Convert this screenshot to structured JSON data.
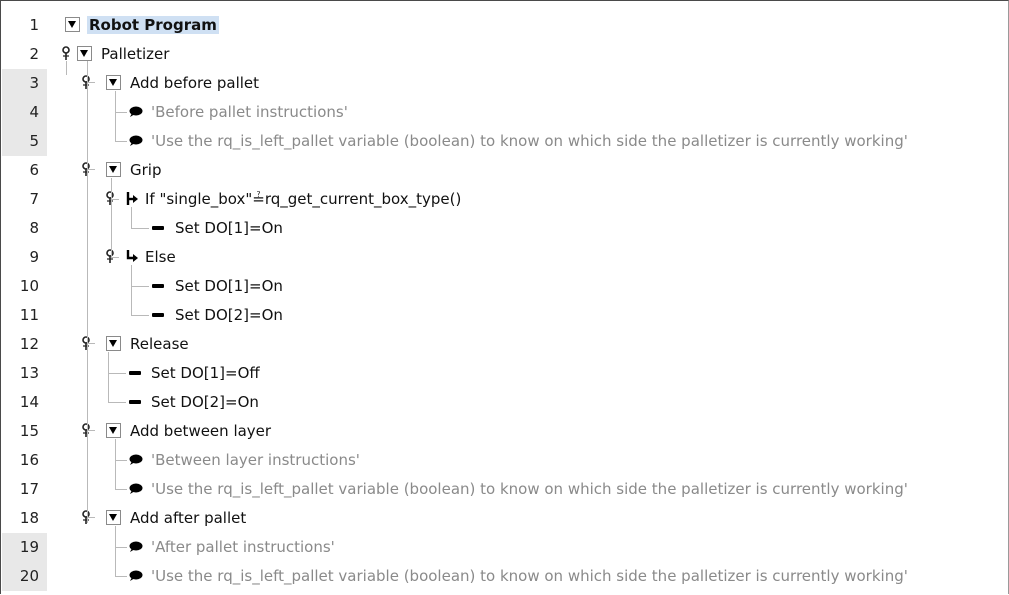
{
  "rows": [
    {
      "num": "1",
      "text": "Robot Program"
    },
    {
      "num": "2",
      "text": "Palletizer"
    },
    {
      "num": "3",
      "text": "Add before pallet"
    },
    {
      "num": "4",
      "text": "'Before pallet instructions'"
    },
    {
      "num": "5",
      "text": "'Use the rq_is_left_pallet variable (boolean) to know on which side the palletizer is currently working'"
    },
    {
      "num": "6",
      "text": "Grip"
    },
    {
      "num": "7",
      "text": "If \"single_box\"≟rq_get_current_box_type()"
    },
    {
      "num": "8",
      "text": "Set DO[1]=On"
    },
    {
      "num": "9",
      "text": "Else"
    },
    {
      "num": "10",
      "text": "Set DO[1]=On"
    },
    {
      "num": "11",
      "text": "Set DO[2]=On"
    },
    {
      "num": "12",
      "text": "Release"
    },
    {
      "num": "13",
      "text": "Set DO[1]=Off"
    },
    {
      "num": "14",
      "text": "Set DO[2]=On"
    },
    {
      "num": "15",
      "text": "Add between layer"
    },
    {
      "num": "16",
      "text": "'Between layer instructions'"
    },
    {
      "num": "17",
      "text": "'Use the rq_is_left_pallet variable (boolean) to know on which side the palletizer is currently working'"
    },
    {
      "num": "18",
      "text": "Add after pallet"
    },
    {
      "num": "19",
      "text": "'After pallet instructions'"
    },
    {
      "num": "20",
      "text": "'Use the rq_is_left_pallet variable (boolean) to know on which side the palletizer is currently working'"
    }
  ],
  "colors": {
    "selection": "#cfe0f3",
    "gutter_shade": "#e8e8e8",
    "comment_text": "#8a8a8a",
    "tree_line": "#b9b9b9"
  }
}
